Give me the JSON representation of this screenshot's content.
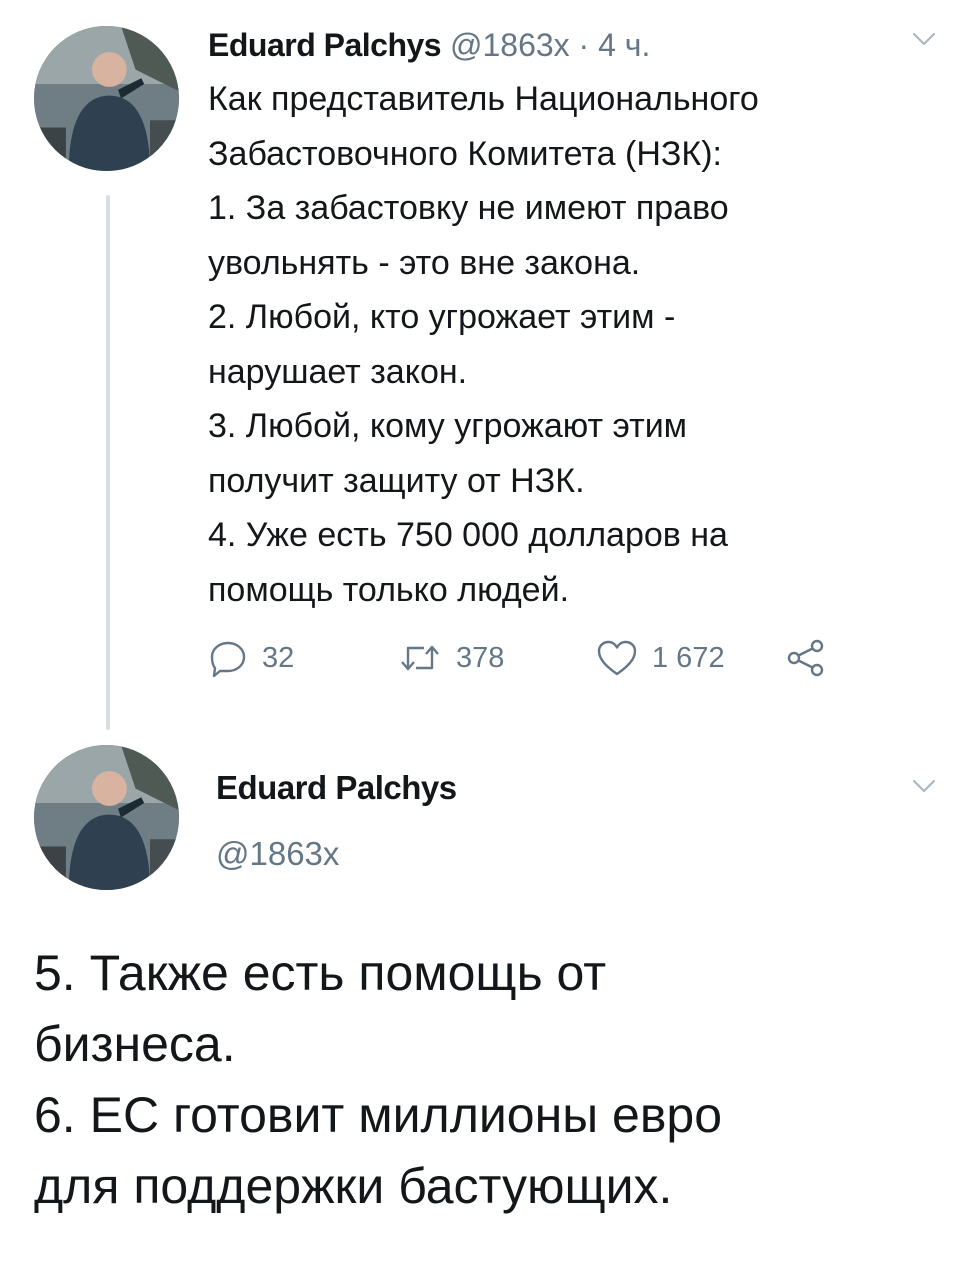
{
  "colors": {
    "text": "#14171a",
    "secondary": "#657786",
    "thread_line": "#d6dee3",
    "background": "#ffffff"
  },
  "tweet1": {
    "author_name": "Eduard Palchys",
    "author_handle": "@1863x",
    "separator": "·",
    "time": "4 ч.",
    "avatar_icon": "avatar-photo",
    "menu_icon": "chevron-down-icon",
    "text_lines": [
      "Как представитель Национального",
      "Забастовочного Комитета (НЗК):",
      "1. За забастовку не имеют право",
      "увольнять - это вне закона.",
      "2. Любой, кто угрожает этим -",
      "нарушает закон.",
      "3. Любой, кому угрожают этим",
      "получит защиту от НЗК.",
      "4. Уже есть 750 000 долларов на",
      "помощь только людей."
    ],
    "actions": {
      "reply_icon": "reply-icon",
      "reply_count": "32",
      "retweet_icon": "retweet-icon",
      "retweet_count": "378",
      "like_icon": "heart-icon",
      "like_count": "1 672",
      "share_icon": "share-icon"
    }
  },
  "tweet2": {
    "author_name": "Eduard Palchys",
    "author_handle": "@1863x",
    "avatar_icon": "avatar-photo",
    "menu_icon": "chevron-down-icon",
    "text_lines": [
      "5. Также есть помощь от",
      "бизнеса.",
      "6. ЕС готовит миллионы евро",
      "для поддержки бастующих."
    ]
  }
}
